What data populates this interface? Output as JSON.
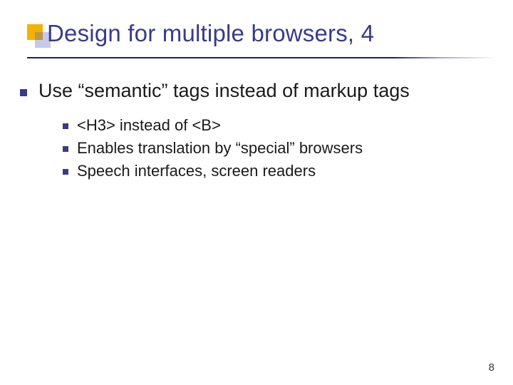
{
  "slide": {
    "title": "Design for multiple browsers, 4",
    "page_number": "8"
  },
  "bullets": {
    "main": "Use “semantic” tags instead of markup tags",
    "sub": [
      "<H3> instead of <B>",
      "Enables translation by “special” browsers",
      "Speech interfaces, screen readers"
    ]
  }
}
